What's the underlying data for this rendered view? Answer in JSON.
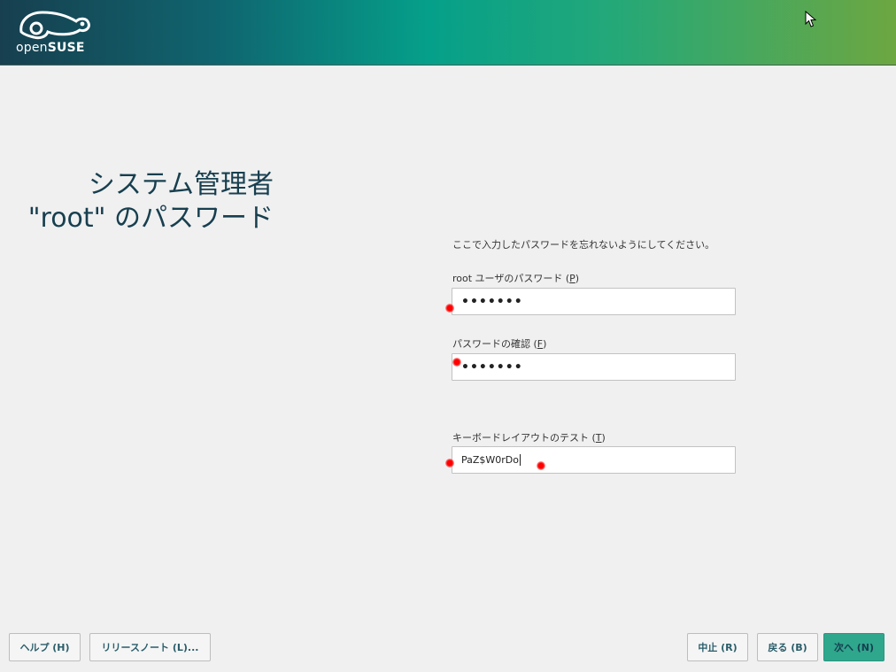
{
  "header": {
    "logo": {
      "open": "open",
      "suse": "SUSE",
      "icon": "chameleon-icon"
    },
    "cursor_icon": "mouse-pointer-icon"
  },
  "title": {
    "line1": "システム管理者",
    "line2": "\"root\" のパスワード"
  },
  "hint": "ここで入力したパスワードを忘れないようにしてください。",
  "fields": [
    {
      "label": "root ユーザのパスワード (",
      "mnemonic": "P",
      "label_end": ")",
      "value": "•••••••",
      "type": "password"
    },
    {
      "label": "パスワードの確認 (",
      "mnemonic": "F",
      "label_end": ")",
      "value": "•••••••",
      "type": "password"
    },
    {
      "label": "キーボードレイアウトのテスト (",
      "mnemonic": "T",
      "label_end": ")",
      "value": "PaZ$W0rDo",
      "type": "text"
    }
  ],
  "buttons": {
    "help": "ヘルプ (H)",
    "release_notes": "リリースノート (L)...",
    "abort": "中止 (R)",
    "back": "戻る (B)",
    "next": "次へ (N)"
  },
  "colors": {
    "brand_dark": "#173f4f",
    "brand_teal": "#05a08a",
    "brand_green": "#6da741",
    "primary_button": "#2fa78d",
    "marker": "#ff0000"
  }
}
